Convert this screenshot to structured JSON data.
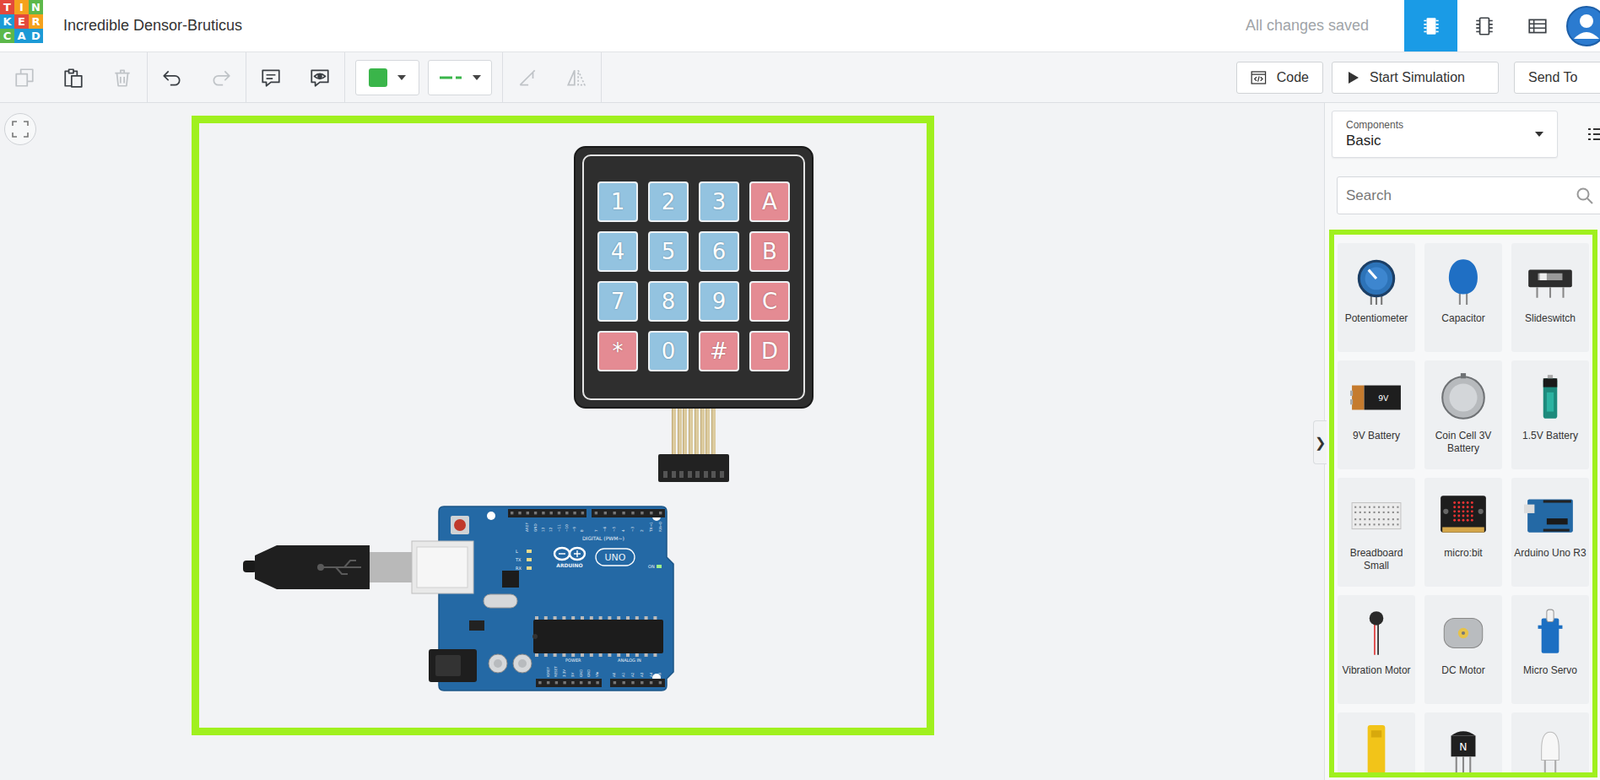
{
  "header": {
    "logo": [
      {
        "letter": "T",
        "color": "#e3493c"
      },
      {
        "letter": "I",
        "color": "#f5a11c"
      },
      {
        "letter": "N",
        "color": "#5cb84a"
      },
      {
        "letter": "K",
        "color": "#1c9ad6"
      },
      {
        "letter": "E",
        "color": "#e3493c"
      },
      {
        "letter": "R",
        "color": "#f5a11c"
      },
      {
        "letter": "C",
        "color": "#5cb84a"
      },
      {
        "letter": "A",
        "color": "#1c9ad6"
      },
      {
        "letter": "D",
        "color": "#1c9ad6"
      }
    ],
    "title": "Incredible Densor-Bruticus",
    "save_status": "All changes saved",
    "views": [
      {
        "kind": "circuit",
        "selected": true
      },
      {
        "kind": "schematic",
        "selected": false
      },
      {
        "kind": "list",
        "selected": false
      }
    ]
  },
  "toolbar": {
    "tool_groups": [
      [
        {
          "kind": "copy",
          "disabled": true
        },
        {
          "kind": "paste",
          "disabled": false
        },
        {
          "kind": "delete",
          "disabled": true
        }
      ],
      [
        {
          "kind": "undo",
          "disabled": false
        },
        {
          "kind": "redo",
          "disabled": true
        }
      ],
      [
        {
          "kind": "notes",
          "disabled": false
        },
        {
          "kind": "notes-visibility",
          "disabled": false
        }
      ]
    ],
    "fill_color": "#3ab54a",
    "wire_color": "#3ab54a",
    "transform_tools": [
      {
        "kind": "rotate",
        "disabled": true
      },
      {
        "kind": "flip",
        "disabled": true
      }
    ],
    "actions": [
      {
        "kind": "code",
        "label": "Code"
      },
      {
        "kind": "simulate",
        "label": "Start Simulation"
      },
      {
        "kind": "send",
        "label": "Send To"
      }
    ]
  },
  "canvas": {
    "highlighted": true,
    "keypad": {
      "keys": [
        {
          "label": "1",
          "color": "#93c3e0"
        },
        {
          "label": "2",
          "color": "#93c3e0"
        },
        {
          "label": "3",
          "color": "#93c3e0"
        },
        {
          "label": "A",
          "color": "#e48b93"
        },
        {
          "label": "4",
          "color": "#93c3e0"
        },
        {
          "label": "5",
          "color": "#93c3e0"
        },
        {
          "label": "6",
          "color": "#93c3e0"
        },
        {
          "label": "B",
          "color": "#e48b93"
        },
        {
          "label": "7",
          "color": "#93c3e0"
        },
        {
          "label": "8",
          "color": "#93c3e0"
        },
        {
          "label": "9",
          "color": "#93c3e0"
        },
        {
          "label": "C",
          "color": "#e48b93"
        },
        {
          "label": "*",
          "color": "#e48b93"
        },
        {
          "label": "0",
          "color": "#93c3e0"
        },
        {
          "label": "#",
          "color": "#e48b93"
        },
        {
          "label": "D",
          "color": "#e48b93"
        }
      ]
    },
    "arduino": {
      "brand": "ARDUINO",
      "model": "UNO",
      "digital_label": "DIGITAL (PWM~)",
      "power_label": "POWER",
      "analog_label": "ANALOG IN",
      "on_label": "ON",
      "led_labels": [
        "L",
        "TX",
        "RX"
      ],
      "digital_pins": [
        "AREF",
        "GND",
        "13",
        "12",
        "~11",
        "~10",
        "~9",
        "8",
        "7",
        "~6",
        "~5",
        "4",
        "~3",
        "2",
        "TX→1",
        "RX←0"
      ],
      "power_pins": [
        "IOREF",
        "RESET",
        "3.3V",
        "5V",
        "GND",
        "GND",
        "Vin"
      ],
      "analog_pins": [
        "A0",
        "A1",
        "A2",
        "A3",
        "A4",
        "A5"
      ]
    }
  },
  "panel": {
    "library_caption": "Components",
    "library": "Basic",
    "search_placeholder": "Search",
    "collapse": "❯",
    "highlighted": true,
    "components": [
      {
        "kind": "potentiometer",
        "label": "Potentiometer"
      },
      {
        "kind": "capacitor",
        "label": "Capacitor"
      },
      {
        "kind": "slideswitch",
        "label": "Slideswitch"
      },
      {
        "kind": "battery-9v",
        "label": "9V Battery",
        "mark": "9V"
      },
      {
        "kind": "coin-cell",
        "label": "Coin Cell 3V Battery"
      },
      {
        "kind": "battery-aa",
        "label": "1.5V Battery"
      },
      {
        "kind": "breadboard",
        "label": "Breadboard Small"
      },
      {
        "kind": "microbit",
        "label": "micro:bit"
      },
      {
        "kind": "arduino",
        "label": "Arduino Uno R3"
      },
      {
        "kind": "vibration-motor",
        "label": "Vibration Motor"
      },
      {
        "kind": "dc-motor",
        "label": "DC Motor"
      },
      {
        "kind": "servo",
        "label": "Micro Servo"
      },
      {
        "kind": "gearmotor"
      },
      {
        "kind": "transistor",
        "mark": "N"
      },
      {
        "kind": "led"
      }
    ]
  }
}
